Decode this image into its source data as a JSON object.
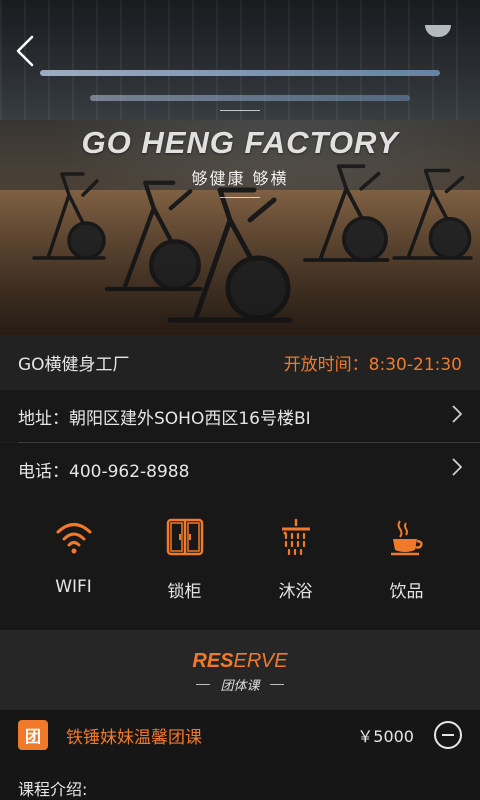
{
  "header": {
    "brand": "GO HENG FACTORY",
    "tagline": "够健康  够横"
  },
  "gym": {
    "name": "GO横健身工厂",
    "hours": "开放时间：8:30-21:30",
    "address": "地址：朝阳区建外SOHO西区16号楼BI",
    "phone": "电话：400-962-8988"
  },
  "amenities": [
    {
      "label": "WIFI",
      "icon": "wifi-icon"
    },
    {
      "label": "锁柜",
      "icon": "locker-icon"
    },
    {
      "label": "沐浴",
      "icon": "shower-icon"
    },
    {
      "label": "饮品",
      "icon": "coffee-icon"
    }
  ],
  "reserve": {
    "word_a": "RES",
    "word_b": "ERVE",
    "subtitle": "团体课"
  },
  "course": {
    "icon_char": "团",
    "name": "铁锤妹妹温馨团课",
    "price": "￥5000"
  },
  "intro_label": "课程介绍:",
  "colors": {
    "accent": "#f07a2a",
    "background": "#181818"
  }
}
